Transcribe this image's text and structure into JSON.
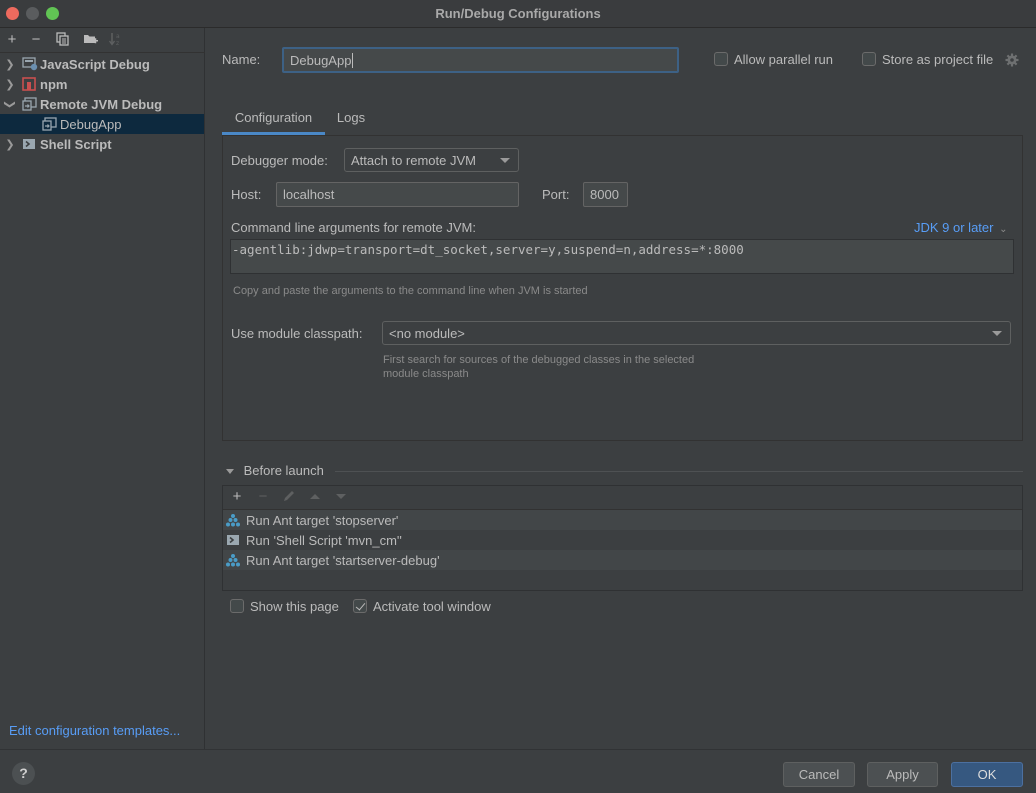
{
  "window": {
    "title": "Run/Debug Configurations"
  },
  "sidebar": {
    "toolbar": [
      {
        "name": "add",
        "icon": "plus-icon",
        "enabled": true
      },
      {
        "name": "remove",
        "icon": "minus-icon",
        "enabled": true
      },
      {
        "name": "copy",
        "icon": "copy-icon",
        "enabled": true
      },
      {
        "name": "new-folder",
        "icon": "folder-plus-icon",
        "enabled": true
      },
      {
        "name": "sort",
        "icon": "sort-alpha-icon",
        "enabled": false
      }
    ],
    "tree": [
      {
        "label": "JavaScript Debug",
        "expanded": false,
        "level": 0,
        "icon": "javascript-debug-icon"
      },
      {
        "label": "npm",
        "expanded": false,
        "level": 0,
        "icon": "npm-icon"
      },
      {
        "label": "Remote JVM Debug",
        "expanded": true,
        "level": 0,
        "icon": "remote-debug-icon"
      },
      {
        "label": "DebugApp",
        "level": 1,
        "selected": true,
        "icon": "remote-debug-icon"
      },
      {
        "label": "Shell Script",
        "expanded": false,
        "level": 0,
        "icon": "shell-script-icon"
      }
    ],
    "edit_templates_link": "Edit configuration templates..."
  },
  "header": {
    "name_label": "Name:",
    "name_value": "DebugApp",
    "allow_parallel_label": "Allow parallel run",
    "allow_parallel_checked": false,
    "store_project_label": "Store as project file",
    "store_project_checked": false
  },
  "tabs": [
    {
      "label": "Configuration",
      "active": true
    },
    {
      "label": "Logs",
      "active": false
    }
  ],
  "config": {
    "debugger_mode_label": "Debugger mode:",
    "debugger_mode_value": "Attach to remote JVM",
    "host_label": "Host:",
    "host_value": "localhost",
    "port_label": "Port:",
    "port_value": "8000",
    "args_label": "Command line arguments for remote JVM:",
    "jdk_selector": "JDK 9 or later",
    "args_value": "-agentlib:jdwp=transport=dt_socket,server=y,suspend=n,address=*:8000",
    "args_hint": "Copy and paste the arguments to the command line when JVM is started",
    "module_label": "Use module classpath:",
    "module_value": "<no module>",
    "module_hint_line1": "First search for sources of the debugged classes in the selected",
    "module_hint_line2": "module classpath"
  },
  "before_launch": {
    "title": "Before launch",
    "toolbar": [
      {
        "name": "add",
        "icon": "plus-icon",
        "enabled": true
      },
      {
        "name": "remove",
        "icon": "minus-icon",
        "enabled": false
      },
      {
        "name": "edit",
        "icon": "pencil-icon",
        "enabled": false
      },
      {
        "name": "move-up",
        "icon": "arrow-up-icon",
        "enabled": false
      },
      {
        "name": "move-down",
        "icon": "arrow-down-icon",
        "enabled": false
      }
    ],
    "tasks": [
      {
        "label": "Run Ant target 'stopserver'",
        "icon": "ant-icon"
      },
      {
        "label": "Run 'Shell Script 'mvn_cm''",
        "icon": "shell-script-icon"
      },
      {
        "label": "Run Ant target 'startserver-debug'",
        "icon": "ant-icon"
      }
    ],
    "show_page_label": "Show this page",
    "show_page_checked": false,
    "activate_tool_label": "Activate tool window",
    "activate_tool_checked": true
  },
  "footer": {
    "help": "?",
    "cancel": "Cancel",
    "apply": "Apply",
    "ok": "OK"
  },
  "colors": {
    "accent": "#4a88c7",
    "link": "#589df6",
    "primary_button": "#365880",
    "selection": "#0d293e",
    "background": "#3c3f41"
  }
}
